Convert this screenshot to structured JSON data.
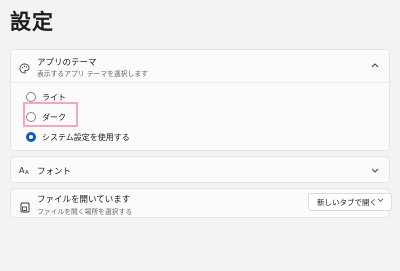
{
  "page": {
    "title": "設定"
  },
  "app_theme": {
    "label": "アプリのテーマ",
    "description": "表示するアプリ テーマを選択します",
    "icon": "palette-icon",
    "options": [
      {
        "label": "ライト",
        "selected": false
      },
      {
        "label": "ダーク",
        "selected": false
      },
      {
        "label": "システム設定を使用する",
        "selected": true
      }
    ]
  },
  "font": {
    "label": "フォント",
    "icon": "font-icon"
  },
  "open_file": {
    "label": "ファイルを開いています",
    "description": "ファイルを開く場所を選択する",
    "icon": "open-file-icon",
    "dropdown_value": "新しいタブで開く"
  },
  "colors": {
    "accent": "#0a5fb4",
    "highlight": "#f1a7cb"
  }
}
